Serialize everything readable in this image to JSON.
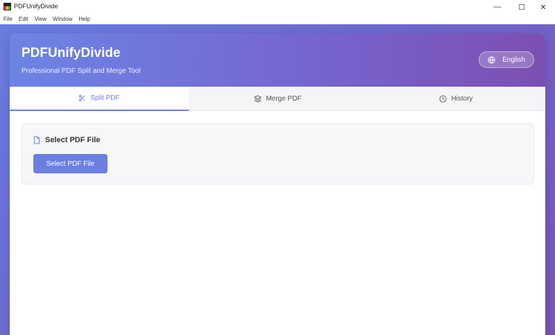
{
  "window": {
    "title": "PDFUnifyDivide",
    "min_glyph": "—",
    "max_glyph": "☐",
    "close_glyph": "✕"
  },
  "menu": [
    "File",
    "Edit",
    "View",
    "Window",
    "Help"
  ],
  "header": {
    "app_name": "PDFUnifyDivide",
    "subtitle": "Professional PDF Split and Merge Tool",
    "language": "English"
  },
  "tabs": [
    {
      "label": "Split PDF",
      "icon": "scissors-icon",
      "active": true
    },
    {
      "label": "Merge PDF",
      "icon": "layers-icon",
      "active": false
    },
    {
      "label": "History",
      "icon": "clock-icon",
      "active": false
    }
  ],
  "select_section": {
    "title": "Select PDF File",
    "button_label": "Select PDF File"
  },
  "colors": {
    "accent": "#6a7fe0",
    "gradient_start": "#6d84e5",
    "gradient_end": "#7c4fb2"
  }
}
